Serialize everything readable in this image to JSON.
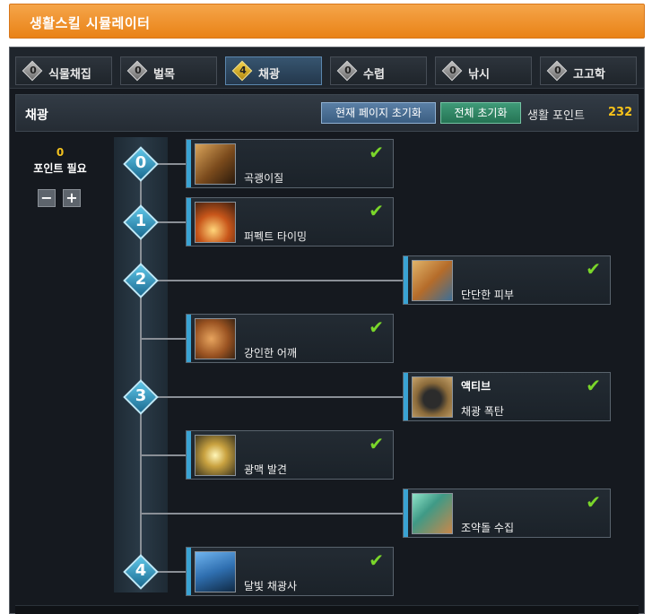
{
  "app_title": "생활스킬 시뮬레이터",
  "tabs": [
    {
      "label": "식물채집",
      "points": "0",
      "active": false
    },
    {
      "label": "벌목",
      "points": "0",
      "active": false
    },
    {
      "label": "채광",
      "points": "4",
      "active": true
    },
    {
      "label": "수렵",
      "points": "0",
      "active": false
    },
    {
      "label": "낚시",
      "points": "0",
      "active": false
    },
    {
      "label": "고고학",
      "points": "0",
      "active": false
    }
  ],
  "header": {
    "title": "채광",
    "reset_page_label": "현재 페이지 초기화",
    "reset_all_label": "전체 초기화",
    "points_label": "생활 포인트",
    "points_value": "232"
  },
  "requirement": {
    "value": "0",
    "label": "포인트 필요",
    "minus": "−",
    "plus": "+"
  },
  "levels": [
    "0",
    "1",
    "2",
    "3",
    "4"
  ],
  "skills": [
    {
      "name": "곡괭이질",
      "tag": "",
      "learned": true,
      "icon": "pickaxe-swing-icon"
    },
    {
      "name": "퍼펙트 타이밍",
      "tag": "",
      "learned": true,
      "icon": "perfect-timing-icon"
    },
    {
      "name": "단단한 피부",
      "tag": "",
      "learned": true,
      "icon": "hard-skin-icon"
    },
    {
      "name": "강인한 어깨",
      "tag": "",
      "learned": true,
      "icon": "strong-shoulder-icon"
    },
    {
      "name": "채광 폭탄",
      "tag": "액티브",
      "learned": true,
      "icon": "mining-bomb-icon"
    },
    {
      "name": "광맥 발견",
      "tag": "",
      "learned": true,
      "icon": "vein-discovery-icon"
    },
    {
      "name": "조약돌 수집",
      "tag": "",
      "learned": true,
      "icon": "pebble-collect-icon"
    },
    {
      "name": "달빛 채광사",
      "tag": "",
      "learned": true,
      "icon": "moonlight-miner-icon"
    }
  ],
  "check_glyph": "✔",
  "colors": {
    "accent_orange": "#e98216",
    "check_green": "#7ad62a",
    "points_gold": "#f6c21a",
    "card_bar_blue": "#3aa3d3"
  }
}
